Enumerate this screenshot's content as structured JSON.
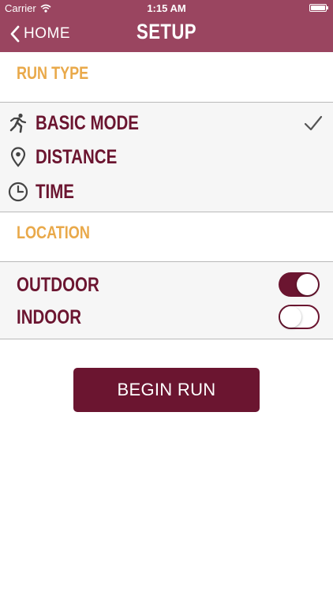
{
  "status_bar": {
    "carrier": "Carrier",
    "time": "1:15 AM"
  },
  "nav": {
    "back_label": "HOME",
    "title": "SETUP"
  },
  "run_type": {
    "header": "RUN TYPE",
    "options": [
      {
        "label": "BASIC MODE",
        "icon": "runner-icon",
        "selected": true
      },
      {
        "label": "DISTANCE",
        "icon": "location-pin-icon",
        "selected": false
      },
      {
        "label": "TIME",
        "icon": "clock-icon",
        "selected": false
      }
    ]
  },
  "location": {
    "header": "LOCATION",
    "options": [
      {
        "label": "OUTDOOR",
        "enabled": true
      },
      {
        "label": "INDOOR",
        "enabled": false
      }
    ]
  },
  "begin_button": {
    "label": "BEGIN RUN"
  },
  "colors": {
    "nav_bar": "#9a4560",
    "primary": "#6b1530",
    "section_header": "#e9a94a"
  }
}
